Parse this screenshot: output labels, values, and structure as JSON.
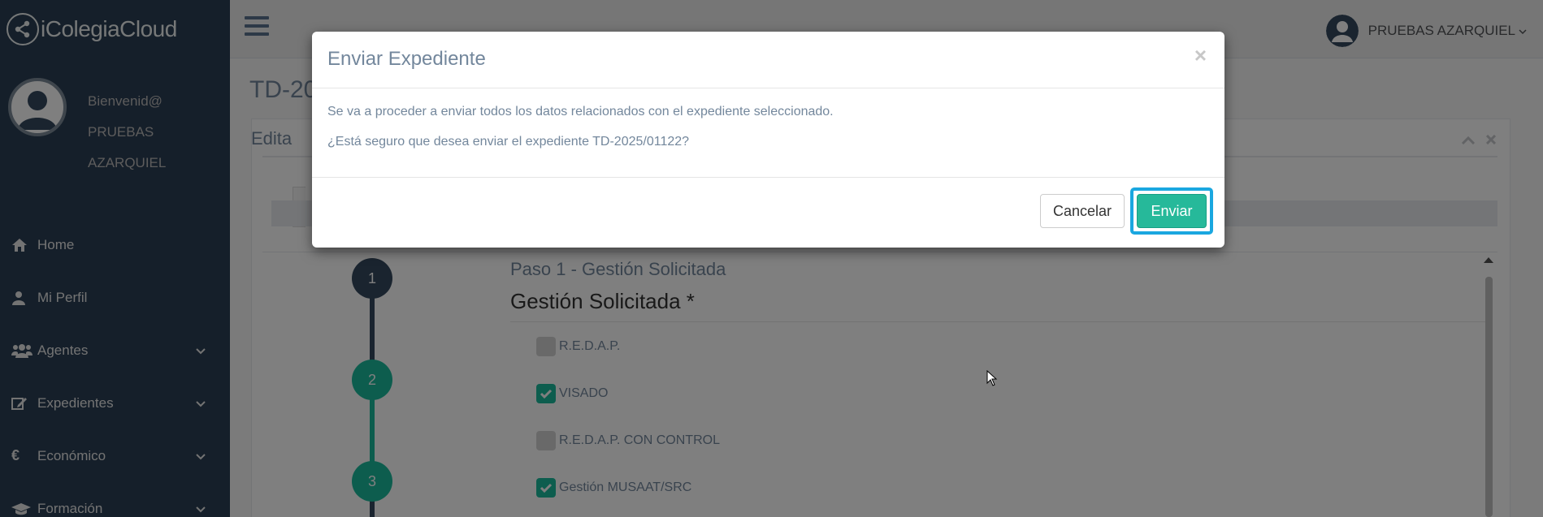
{
  "app": {
    "brand_name": "iColegiaCloud"
  },
  "profile": {
    "welcome": "Bienvenid@",
    "first_name": "PRUEBAS",
    "last_name": "AZARQUIEL"
  },
  "sidebar": {
    "items": [
      {
        "label": "Home",
        "icon": "home-icon",
        "expandable": false
      },
      {
        "label": "Mi Perfil",
        "icon": "user-icon",
        "expandable": false
      },
      {
        "label": "Agentes",
        "icon": "users-icon",
        "expandable": true
      },
      {
        "label": "Expedientes",
        "icon": "edit-icon",
        "expandable": true
      },
      {
        "label": "Económico",
        "icon": "euro-icon",
        "expandable": true
      },
      {
        "label": "Formación",
        "icon": "graduation-cap-icon",
        "expandable": true
      }
    ]
  },
  "header": {
    "user_name": "PRUEBAS AZARQUIEL"
  },
  "main": {
    "page_title": "TD-20",
    "panel_title": "Edita",
    "wizard": {
      "step_label": "Paso 1 - Gestión Solicitada",
      "section_title": "Gestión Solicitada *",
      "steps": [
        "1",
        "2",
        "3"
      ],
      "options": [
        {
          "label": "R.E.D.A.P.",
          "checked": false
        },
        {
          "label": "VISADO",
          "checked": true
        },
        {
          "label": "R.E.D.A.P. CON CONTROL",
          "checked": false
        },
        {
          "label": "Gestión MUSAAT/SRC",
          "checked": true
        }
      ]
    }
  },
  "modal": {
    "title": "Enviar Expediente",
    "close_symbol": "×",
    "message_1": "Se va a proceder a enviar todos los datos relacionados con el expediente seleccionado.",
    "message_2": "¿Está seguro que desea enviar el expediente TD-2025/01122?",
    "cancel_label": "Cancelar",
    "send_label": "Enviar"
  },
  "colors": {
    "sidebar_bg": "#2a3f54",
    "accent_green": "#26b99a",
    "step_dark": "#34495e",
    "step_green": "#1abb9c",
    "focus_ring": "#1aa7e0"
  }
}
